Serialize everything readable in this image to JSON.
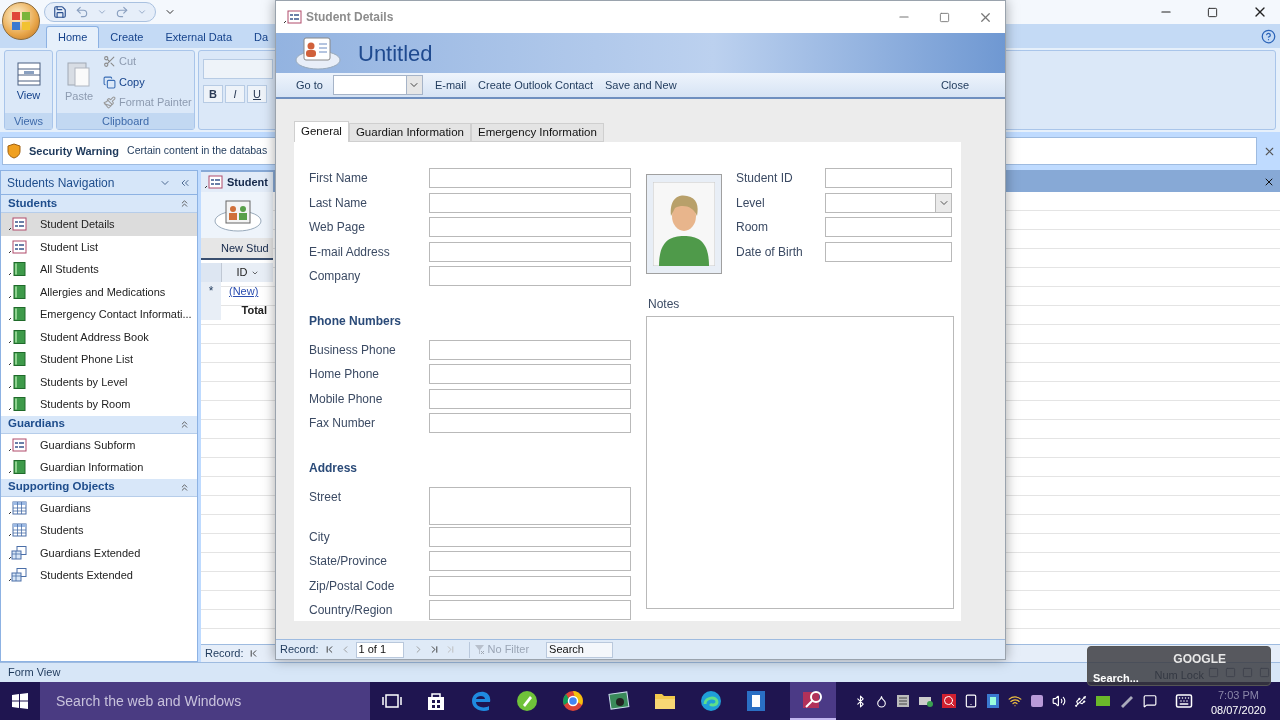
{
  "ribbon": {
    "tabs": [
      {
        "label": "Home",
        "selected": true
      },
      {
        "label": "Create",
        "selected": false
      },
      {
        "label": "External Data",
        "selected": false
      },
      {
        "label": "Da",
        "selected": false
      }
    ],
    "views": {
      "button": "View",
      "group": "Views"
    },
    "clipboard": {
      "paste": {
        "label": "Paste",
        "disabled": true
      },
      "items": [
        {
          "label": "Cut",
          "kind": "cut",
          "disabled": true
        },
        {
          "label": "Copy",
          "kind": "copy",
          "disabled": false
        },
        {
          "label": "Format Painter",
          "kind": "painter",
          "disabled": true
        }
      ],
      "group": "Clipboard"
    },
    "font_buttons": [
      "B",
      "I",
      "U"
    ]
  },
  "security_bar": {
    "title": "Security Warning",
    "message": "Certain content in the databas"
  },
  "navigation": {
    "title": "Students Navigation",
    "groups": [
      {
        "name": "Students",
        "expanded": true,
        "items": [
          {
            "label": "Student Details",
            "kind": "form",
            "selected": true
          },
          {
            "label": "Student List",
            "kind": "form",
            "selected": false
          },
          {
            "label": "All Students",
            "kind": "report",
            "selected": false
          },
          {
            "label": "Allergies and Medications",
            "kind": "report",
            "selected": false
          },
          {
            "label": "Emergency Contact Informati...",
            "kind": "report",
            "selected": false
          },
          {
            "label": "Student Address Book",
            "kind": "report",
            "selected": false
          },
          {
            "label": "Student Phone List",
            "kind": "report",
            "selected": false
          },
          {
            "label": "Students by Level",
            "kind": "report",
            "selected": false
          },
          {
            "label": "Students by Room",
            "kind": "report",
            "selected": false
          }
        ]
      },
      {
        "name": "Guardians",
        "expanded": true,
        "items": [
          {
            "label": "Guardians Subform",
            "kind": "form",
            "selected": false
          },
          {
            "label": "Guardian Information",
            "kind": "report",
            "selected": false
          }
        ]
      },
      {
        "name": "Supporting Objects",
        "expanded": true,
        "items": [
          {
            "label": "Guardians",
            "kind": "table",
            "selected": false
          },
          {
            "label": "Students",
            "kind": "table",
            "selected": false
          },
          {
            "label": "Guardians Extended",
            "kind": "query",
            "selected": false
          },
          {
            "label": "Students Extended",
            "kind": "query",
            "selected": false
          }
        ]
      }
    ]
  },
  "document": {
    "tab": "Student",
    "new_button": "New Stud",
    "column": "ID",
    "new_marker": "*",
    "new_row": "(New)",
    "total_row": "Total",
    "record_label": "Record:"
  },
  "dialog": {
    "title": "Student Details",
    "header": "Untitled",
    "toolbar": {
      "goto": {
        "label": "Go to"
      },
      "links": [
        {
          "label": "E-mail"
        },
        {
          "label": "Create Outlook Contact"
        },
        {
          "label": "Save and New"
        }
      ],
      "close": {
        "label": "Close"
      }
    },
    "tabs": [
      {
        "label": "General",
        "selected": true
      },
      {
        "label": "Guardian Information",
        "selected": false
      },
      {
        "label": "Emergency Information",
        "selected": false
      }
    ],
    "left_sections": [
      {
        "fields": [
          {
            "label": "First Name",
            "kind": "text"
          },
          {
            "label": "Last Name",
            "kind": "text"
          },
          {
            "label": "Web Page",
            "kind": "text"
          },
          {
            "label": "E-mail Address",
            "kind": "text"
          },
          {
            "label": "Company",
            "kind": "text"
          }
        ]
      },
      {
        "heading": "Phone Numbers",
        "fields": [
          {
            "label": "Business Phone",
            "kind": "text"
          },
          {
            "label": "Home Phone",
            "kind": "text"
          },
          {
            "label": "Mobile Phone",
            "kind": "text"
          },
          {
            "label": "Fax Number",
            "kind": "text"
          }
        ]
      },
      {
        "heading": "Address",
        "fields": [
          {
            "label": "Street",
            "kind": "multiline"
          },
          {
            "label": "City",
            "kind": "text"
          },
          {
            "label": "State/Province",
            "kind": "text"
          },
          {
            "label": "Zip/Postal Code",
            "kind": "text"
          },
          {
            "label": "Country/Region",
            "kind": "text"
          }
        ]
      }
    ],
    "right_fields": [
      {
        "label": "Student ID",
        "kind": "text"
      },
      {
        "label": "Level",
        "kind": "combo"
      },
      {
        "label": "Room",
        "kind": "text"
      },
      {
        "label": "Date of Birth",
        "kind": "text"
      }
    ],
    "notes_label": "Notes",
    "record_nav": {
      "label": "Record:",
      "position": "1 of 1",
      "filter": "No Filter",
      "search_placeholder": "Search"
    }
  },
  "status_bar": {
    "view": "Form View",
    "num_lock": "Num Lock"
  },
  "taskbar": {
    "search_placeholder": "Search the web and Windows",
    "time": "7:03 PM",
    "date": "08/07/2020"
  },
  "tooltip": {
    "title": "GOOGLE",
    "text": "Search..."
  }
}
